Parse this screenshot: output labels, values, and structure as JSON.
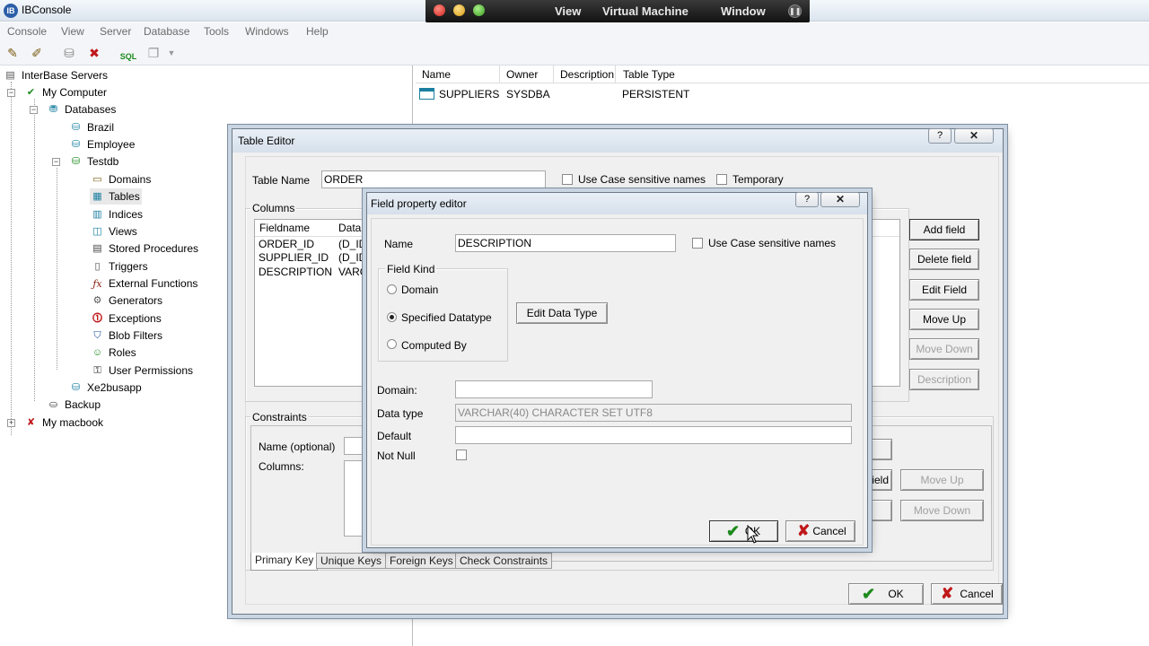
{
  "app": {
    "title": "IBConsole",
    "icon_text": "IB"
  },
  "vm_bar": {
    "items": [
      "View",
      "Virtual Machine",
      "Window"
    ]
  },
  "menubar": {
    "items": [
      "Console",
      "View",
      "Server",
      "Database",
      "Tools",
      "Windows",
      "Help"
    ]
  },
  "tree": {
    "root": "InterBase Servers",
    "server": "My Computer",
    "databases": "Databases",
    "db1": "Brazil",
    "db2": "Employee",
    "db3": "Testdb",
    "children": [
      "Domains",
      "Tables",
      "Indices",
      "Views",
      "Stored Procedures",
      "Triggers",
      "External Functions",
      "Generators",
      "Exceptions",
      "Blob Filters",
      "Roles",
      "User Permissions"
    ],
    "db4": "Xe2busapp",
    "backup": "Backup",
    "server2": "My macbook",
    "sql_label": "SQL"
  },
  "list": {
    "headers": [
      "Name",
      "Owner",
      "Description",
      "Table Type"
    ],
    "rows": [
      {
        "name": "SUPPLIERS",
        "owner": "SYSDBA",
        "description": "",
        "type": "PERSISTENT"
      }
    ]
  },
  "table_editor": {
    "title": "Table Editor",
    "help_glyph": "?",
    "close_glyph": "✕",
    "table_name_label": "Table Name",
    "table_name_value": "ORDER",
    "case_sensitive_label": "Use Case sensitive names",
    "temporary_label": "Temporary",
    "columns_label": "Columns",
    "column_headers": [
      "Fieldname",
      "Data"
    ],
    "columns": [
      {
        "name": "ORDER_ID",
        "type": "(D_ID"
      },
      {
        "name": "SUPPLIER_ID",
        "type": "(D_ID"
      },
      {
        "name": "DESCRIPTION",
        "type": "VARC"
      }
    ],
    "buttons": [
      "Add field",
      "Delete field",
      "Edit Field",
      "Move Up",
      "Move Down",
      "Description"
    ],
    "constraints_label": "Constraints",
    "name_optional_label": "Name (optional)",
    "constraint_columns_label": "Columns:",
    "partial_field_label": "field",
    "move_up": "Move Up",
    "move_down": "Move Down",
    "tabs": [
      "Primary Key",
      "Unique Keys",
      "Foreign Keys",
      "Check Constraints"
    ],
    "ok": "OK",
    "cancel": "Cancel"
  },
  "field_editor": {
    "title": "Field property editor",
    "help_glyph": "?",
    "close_glyph": "✕",
    "name_label": "Name",
    "name_value": "DESCRIPTION",
    "case_sensitive_label": "Use Case sensitive names",
    "field_kind_label": "Field Kind",
    "kinds": [
      "Domain",
      "Specified Datatype",
      "Computed By"
    ],
    "selected_kind": "Specified Datatype",
    "edit_data_type": "Edit Data Type",
    "domain_label": "Domain:",
    "domain_value": "",
    "data_type_label": "Data type",
    "data_type_value": "VARCHAR(40) CHARACTER SET UTF8",
    "default_label": "Default",
    "default_value": "",
    "not_null_label": "Not Null",
    "ok": "OK",
    "cancel": "Cancel"
  },
  "colors": {
    "accent": "#2b5ea8",
    "check_green": "#1c8a1c",
    "cancel_red": "#c0181a"
  }
}
